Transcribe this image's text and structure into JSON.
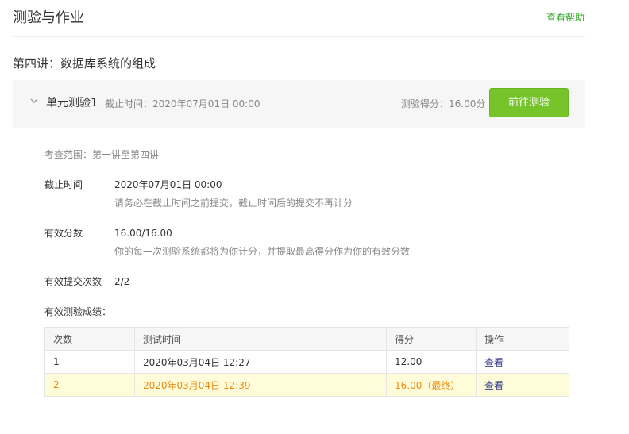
{
  "header": {
    "title": "测验与作业",
    "help_link": "查看帮助"
  },
  "lecture": {
    "title": "第四讲：数据库系统的组成"
  },
  "quiz": {
    "name": "单元测验1",
    "deadline_inline": "截止时间：2020年07月01日 00:00",
    "score_inline": "测验得分：16.00分",
    "go_button": "前往测验",
    "scope": "考查范围：第一讲至第四讲",
    "deadline_label": "截止时间",
    "deadline_value": "2020年07月01日 00:00",
    "deadline_note": "请务必在截止时间之前提交，截止时间后的提交不再计分",
    "valid_score_label": "有效分数",
    "valid_score_value": "16.00/16.00",
    "valid_score_note": "你的每一次测验系统都将为你计分，并提取最高得分作为你的有效分数",
    "submissions_label": "有效提交次数",
    "submissions_value": "2/2",
    "scores_heading": "有效测验成绩："
  },
  "table": {
    "headers": {
      "count": "次数",
      "time": "测试时间",
      "score": "得分",
      "action": "操作"
    },
    "rows": [
      {
        "count": "1",
        "time": "2020年03月04日 12:27",
        "score": "12.00",
        "action": "查看"
      },
      {
        "count": "2",
        "time": "2020年03月04日 12:39",
        "score": "16.00（最终）",
        "action": "查看"
      }
    ]
  },
  "colors": {
    "accent_green": "#76c32a",
    "help_link_green": "#39a82f",
    "highlight_row_bg": "#fefcd9",
    "highlight_row_text": "#ef8a10",
    "link_purple": "#3d3f8f"
  },
  "icons": {
    "expand": "chevron-down-icon"
  }
}
